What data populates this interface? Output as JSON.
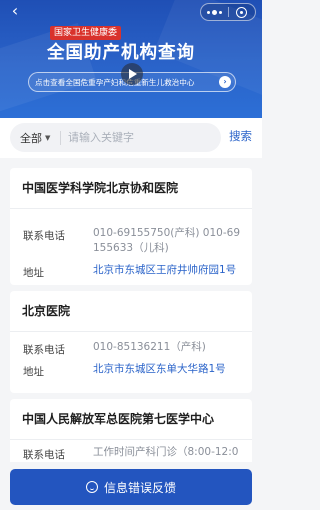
{
  "banner": {
    "back_glyph": "‹",
    "org_tag": "国家卫生健康委",
    "title": "全国助产机构查询",
    "link_text": "点击查看全国危重孕产妇和危重新生儿救治中心",
    "link_arrow": "›",
    "colors": {
      "background": "#2a63c9",
      "tag": "#d9322c"
    }
  },
  "search": {
    "scope": "全部",
    "placeholder": "请输入关键字",
    "value": "",
    "button": "搜索"
  },
  "labels": {
    "phone": "联系电话",
    "address": "地址",
    "hours": "工作时间"
  },
  "hospitals": [
    {
      "name": "中国医学科学院北京协和医院",
      "phone": "010-69155750(产科) 010-69155633（儿科)",
      "address": "北京市东城区王府井帅府园1号"
    },
    {
      "name": "北京医院",
      "phone": "010-85136211（产科)",
      "address": "北京市东城区东单大华路1号"
    },
    {
      "name": "中国人民解放军总医院第七医学中心",
      "hours": "产科门诊（8:00-12:0"
    }
  ],
  "feedback": {
    "label": "信息错误反馈",
    "color": "#2355bf"
  }
}
